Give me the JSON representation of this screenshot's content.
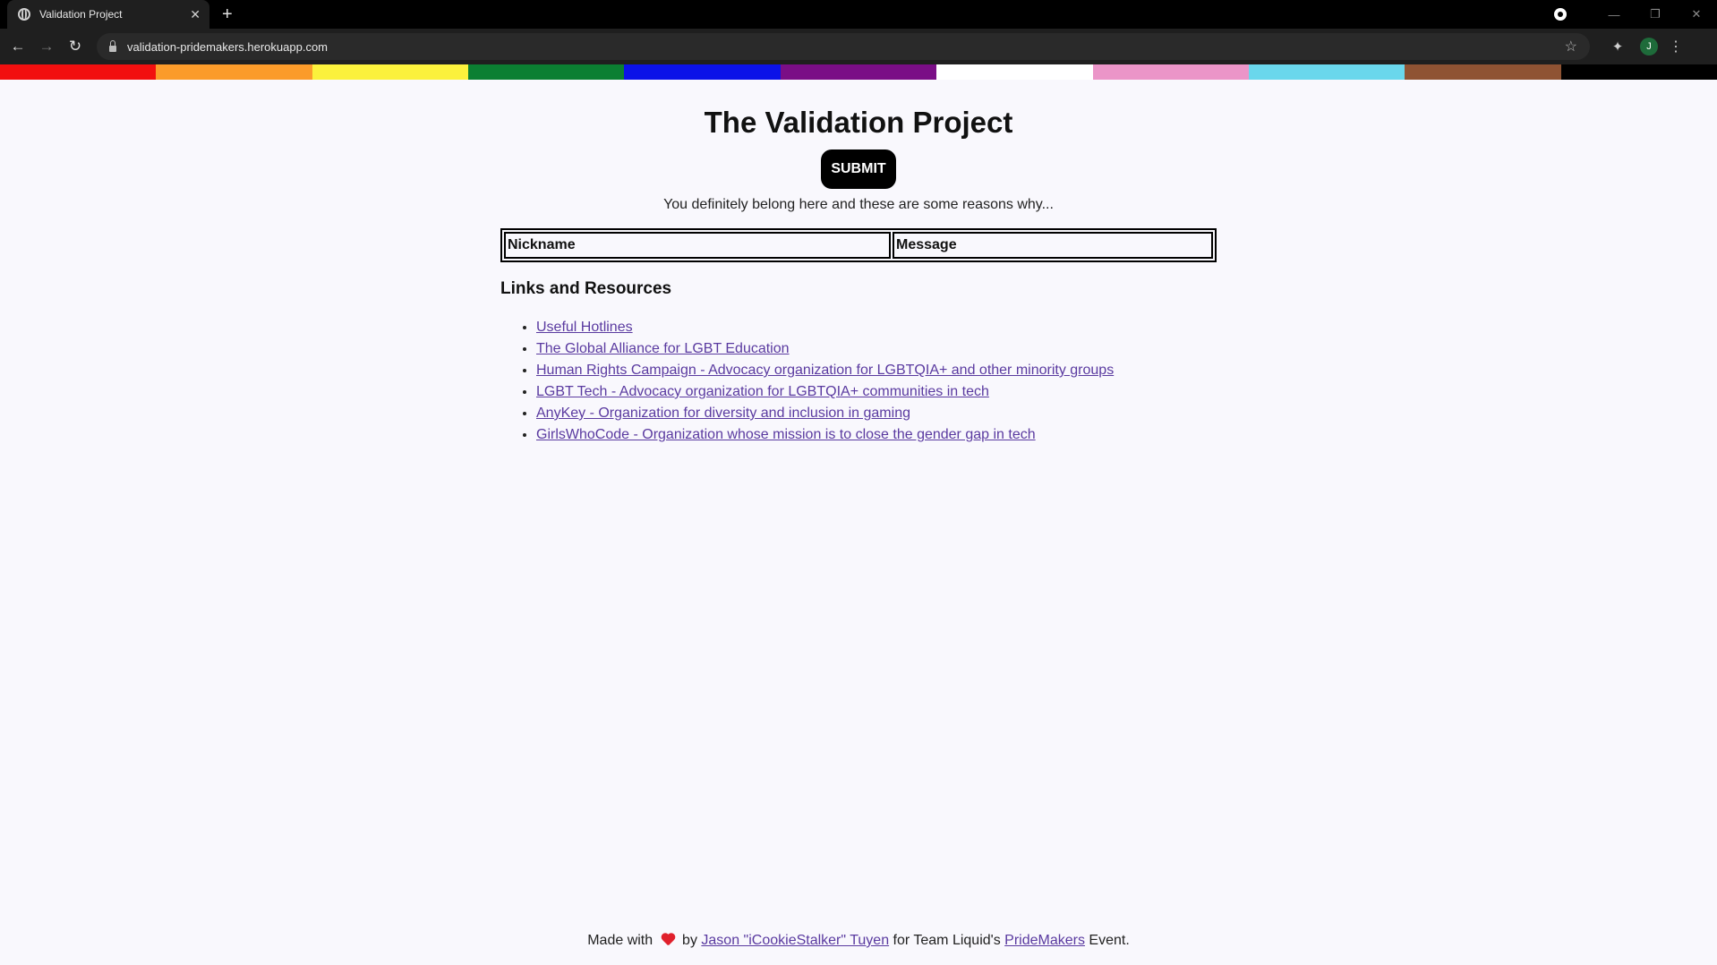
{
  "browser": {
    "tab_title": "Validation Project",
    "tab_close": "✕",
    "new_tab": "+",
    "url": "validation-pridemakers.herokuapp.com",
    "avatar_letter": "J"
  },
  "rainbow_colors": [
    "#f20f0f",
    "#fb9b2a",
    "#fbf13c",
    "#0b7f32",
    "#0b12e8",
    "#7a0e86",
    "#ffffff",
    "#eb95c8",
    "#6ad7ec",
    "#8f5333",
    "#000000"
  ],
  "page": {
    "title": "The Validation Project",
    "submit_label": "SUBMIT",
    "subtitle": "You definitely belong here and these are some reasons why...",
    "table": {
      "columns": [
        "Nickname",
        "Message"
      ]
    },
    "links_heading": "Links and Resources",
    "links": [
      "Useful Hotlines",
      "The Global Alliance for LGBT Education",
      "Human Rights Campaign - Advocacy organization for LGBTQIA+ and other minority groups",
      "LGBT Tech - Advocacy organization for LGBTQIA+ communities in tech",
      "AnyKey - Organization for diversity and inclusion in gaming",
      "GirlsWhoCode - Organization whose mission is to close the gender gap in tech"
    ]
  },
  "footer": {
    "made_with": "Made with",
    "by": "by",
    "author": "Jason \"iCookieStalker\" Tuyen",
    "for_text": "for Team Liquid's",
    "event_link": "PrideMakers",
    "event_suffix": "Event."
  }
}
